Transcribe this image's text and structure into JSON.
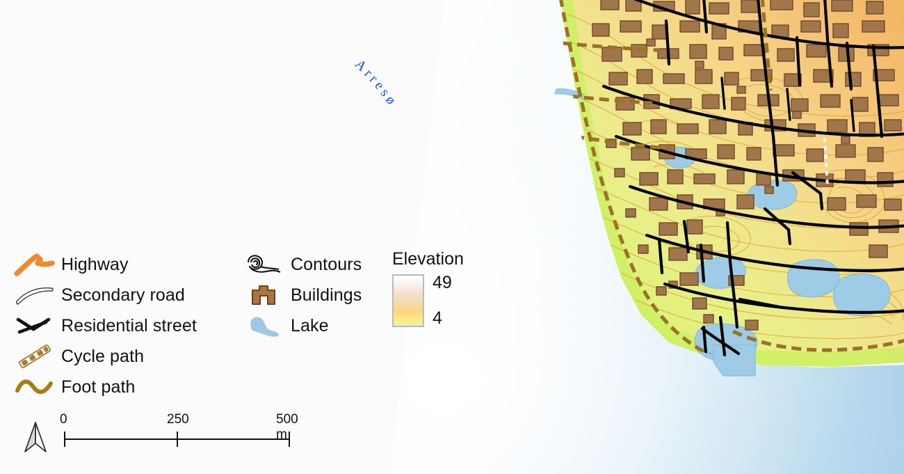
{
  "map": {
    "water_label": "Arresø",
    "water_label_color": "#1a55d8",
    "background_color": "#fbfbfb",
    "sea_color": "#a9d2ea",
    "lake_color": "#9ecfe8",
    "land_low_color": "#ddf07d",
    "land_mid_color": "#efe48a",
    "land_high_color": "#f5c46a",
    "building_color": "#9c7a52",
    "building_outline": "#6b4f33",
    "contour_color": "#e3a83c",
    "road_color": "#000000",
    "cycle_path_color": "#a0742a"
  },
  "legend": {
    "roads": [
      {
        "label": "Highway",
        "icon": "highway-icon"
      },
      {
        "label": "Secondary road",
        "icon": "secondary-road-icon"
      },
      {
        "label": "Residential street",
        "icon": "residential-street-icon"
      },
      {
        "label": "Cycle path",
        "icon": "cycle-path-icon"
      },
      {
        "label": "Foot path",
        "icon": "foot-path-icon"
      }
    ],
    "features": [
      {
        "label": "Contours",
        "icon": "contours-icon"
      },
      {
        "label": "Buildings",
        "icon": "buildings-icon"
      },
      {
        "label": "Lake",
        "icon": "lake-icon"
      }
    ],
    "elevation": {
      "title": "Elevation",
      "max": "49",
      "min": "4",
      "ramp_top_color": "#ffffff",
      "ramp_mid_color": "#f7d9a8",
      "ramp_bottom_color": "#e9f59a"
    }
  },
  "scalebar": {
    "ticks": [
      "0",
      "250",
      "500 m"
    ],
    "unit": "m",
    "max_value": 500,
    "north_arrow": "north-arrow-icon"
  },
  "symbol_colors": {
    "highway": "#f08a2e",
    "secondary_road_fill": "#ffffff",
    "secondary_road_stroke": "#3a3a3a",
    "residential_street": "#121212",
    "cycle_path": "#b07c2c",
    "foot_path": "#a87c17",
    "contours": "#121212",
    "buildings_fill": "#a9763f",
    "buildings_stroke": "#6b4120",
    "lake": "#9ec9e4"
  }
}
